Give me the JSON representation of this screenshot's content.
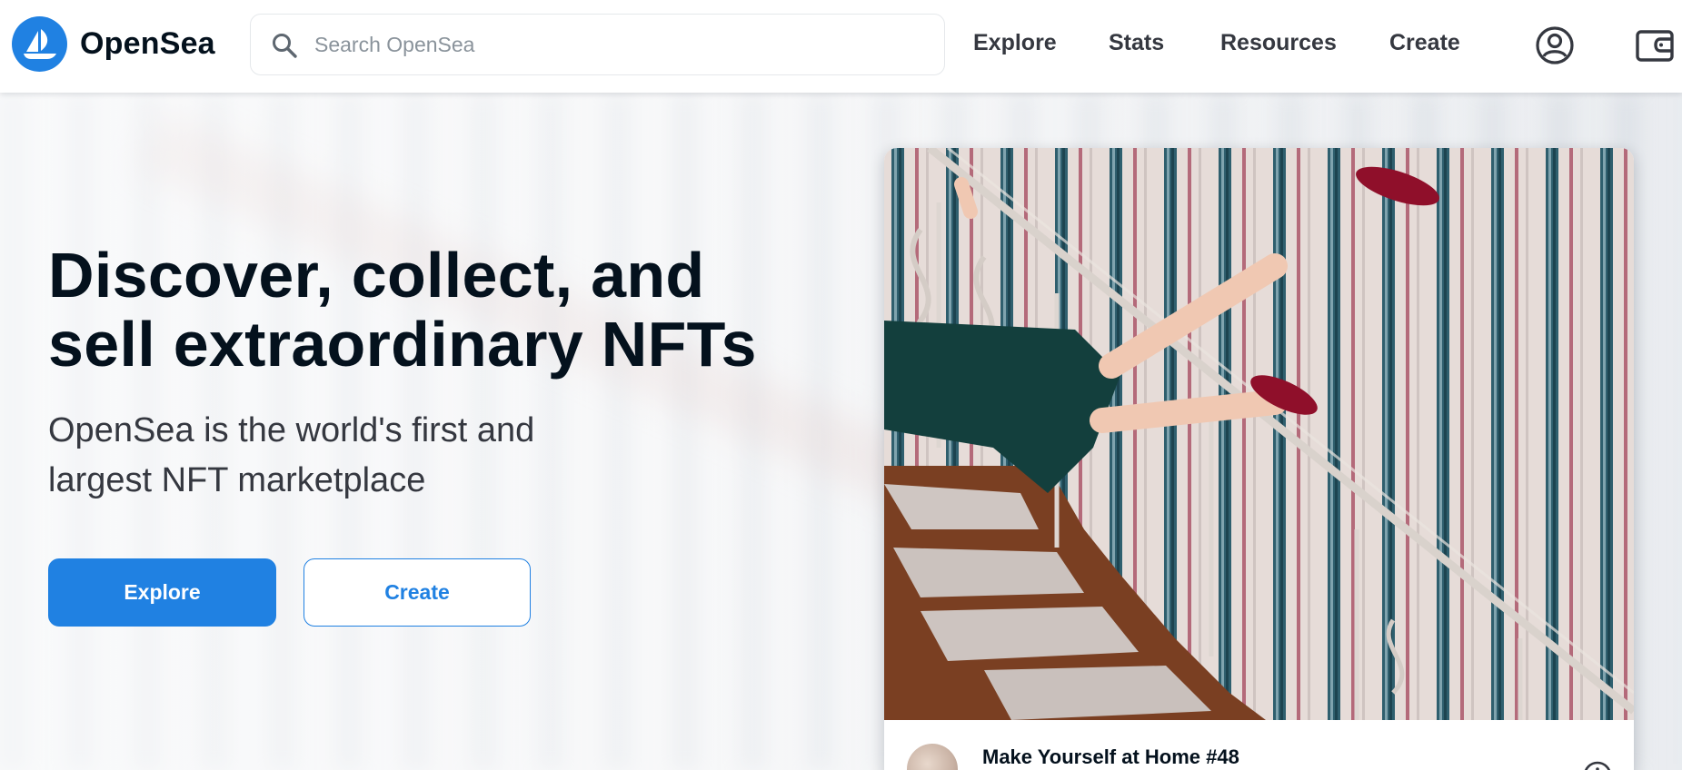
{
  "brand": {
    "name": "OpenSea",
    "logo_icon": "opensea-ship-logo-icon",
    "accent": "#2081e2"
  },
  "search": {
    "placeholder": "Search OpenSea",
    "value": "",
    "icon": "search-icon"
  },
  "nav": {
    "links": [
      {
        "label": "Explore"
      },
      {
        "label": "Stats"
      },
      {
        "label": "Resources"
      },
      {
        "label": "Create"
      }
    ],
    "icons": [
      "account-icon",
      "wallet-icon"
    ]
  },
  "hero": {
    "title": "Discover, collect, and sell extraordinary NFTs",
    "subtitle": "OpenSea is the world's first and largest NFT marketplace",
    "explore_label": "Explore",
    "create_label": "Create"
  },
  "featured": {
    "title": "Make Yourself at Home #48",
    "info_icon": "info-icon"
  },
  "colors": {
    "primary": "#2081e2",
    "text_dark": "#04111d",
    "text_secondary": "#353840",
    "placeholder": "#8a939b",
    "border": "#e5e8eb"
  }
}
